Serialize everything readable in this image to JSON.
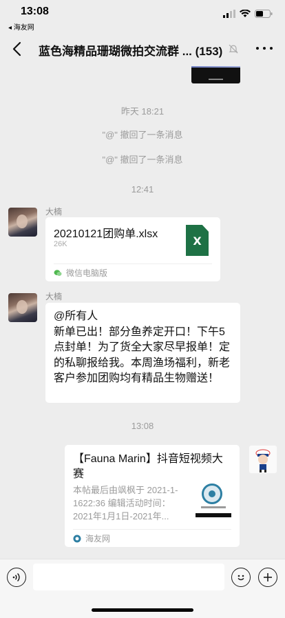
{
  "status_bar": {
    "time": "13:08",
    "back_app": "◂ 海友网"
  },
  "nav": {
    "title": "蓝色海精品珊瑚微拍交流群 ...",
    "count": "(153)"
  },
  "system": {
    "timestamp_1": "昨天 18:21",
    "recall_1": "\"@\" 撤回了一条消息",
    "recall_2": "\"@\" 撤回了一条消息",
    "timestamp_2": "12:41",
    "timestamp_3": "13:08"
  },
  "messages": {
    "file_msg": {
      "sender": "大楠",
      "file_name": "20210121团购单.xlsx",
      "file_size": "26K",
      "file_icon_letter": "X",
      "source": "微信电脑版"
    },
    "text_msg": {
      "sender": "大楠",
      "text": "@所有人\n新单已出！部分鱼养定开口！下午5点封单！为了货全大家尽早报单！定的私聊报给我。本周渔场福利，新老客户参加团购均有精品生物赠送！"
    },
    "share_msg": {
      "title": "【Fauna Marin】抖音短视频大赛",
      "desc": "本帖最后由飒枫于 2021-1-1622:36 编辑活动时间：2021年1月1日-2021年...",
      "source": "海友网"
    }
  },
  "colors": {
    "background": "#ededed",
    "bubble": "#ffffff",
    "excel_green": "#1e7145",
    "system_text": "#9b9b9b"
  }
}
